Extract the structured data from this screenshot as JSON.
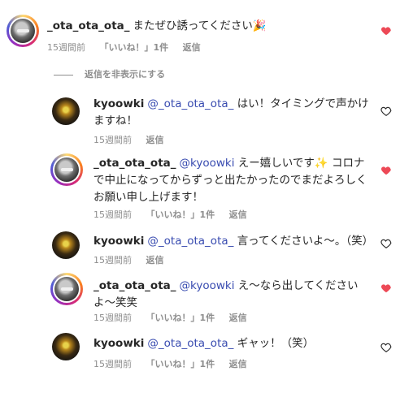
{
  "comments": [
    {
      "username": "_ota_ota_ota_",
      "mention": "",
      "text": "またぜひ誘ってください🎉",
      "time": "15週間前",
      "likes": "「いいね！」1件",
      "reply": "返信",
      "liked": true
    },
    {
      "username": "kyoowki",
      "mention": "@_ota_ota_ota_",
      "text": "はい！タイミングで声かけますね！",
      "time": "15週間前",
      "likes": "",
      "reply": "返信",
      "liked": false
    },
    {
      "username": "_ota_ota_ota_",
      "mention": "@kyoowki",
      "text": "えー嬉しいです✨ コロナで中止になってからずっと出たかったのでまだよろしくお願い申し上げます！",
      "time": "15週間前",
      "likes": "「いいね！」1件",
      "reply": "返信",
      "liked": true
    },
    {
      "username": "kyoowki",
      "mention": "@_ota_ota_ota_",
      "text": "言ってくださいよ〜。（笑）",
      "time": "15週間前",
      "likes": "",
      "reply": "返信",
      "liked": false
    },
    {
      "username": "_ota_ota_ota_",
      "mention": "@kyoowki",
      "text": "え〜なら出してくださいよ〜笑笑",
      "time": "15週間前",
      "likes": "「いいね！」1件",
      "reply": "返信",
      "liked": true
    },
    {
      "username": "kyoowki",
      "mention": "@_ota_ota_ota_",
      "text": "ギャッ！（笑）",
      "time": "15週間前",
      "likes": "「いいね！」1件",
      "reply": "返信",
      "liked": false
    }
  ],
  "hide_replies_label": "返信を非表示にする",
  "colors": {
    "liked_heart": "#ed4956",
    "mention": "#384bb0",
    "meta": "#8e8e8e"
  }
}
